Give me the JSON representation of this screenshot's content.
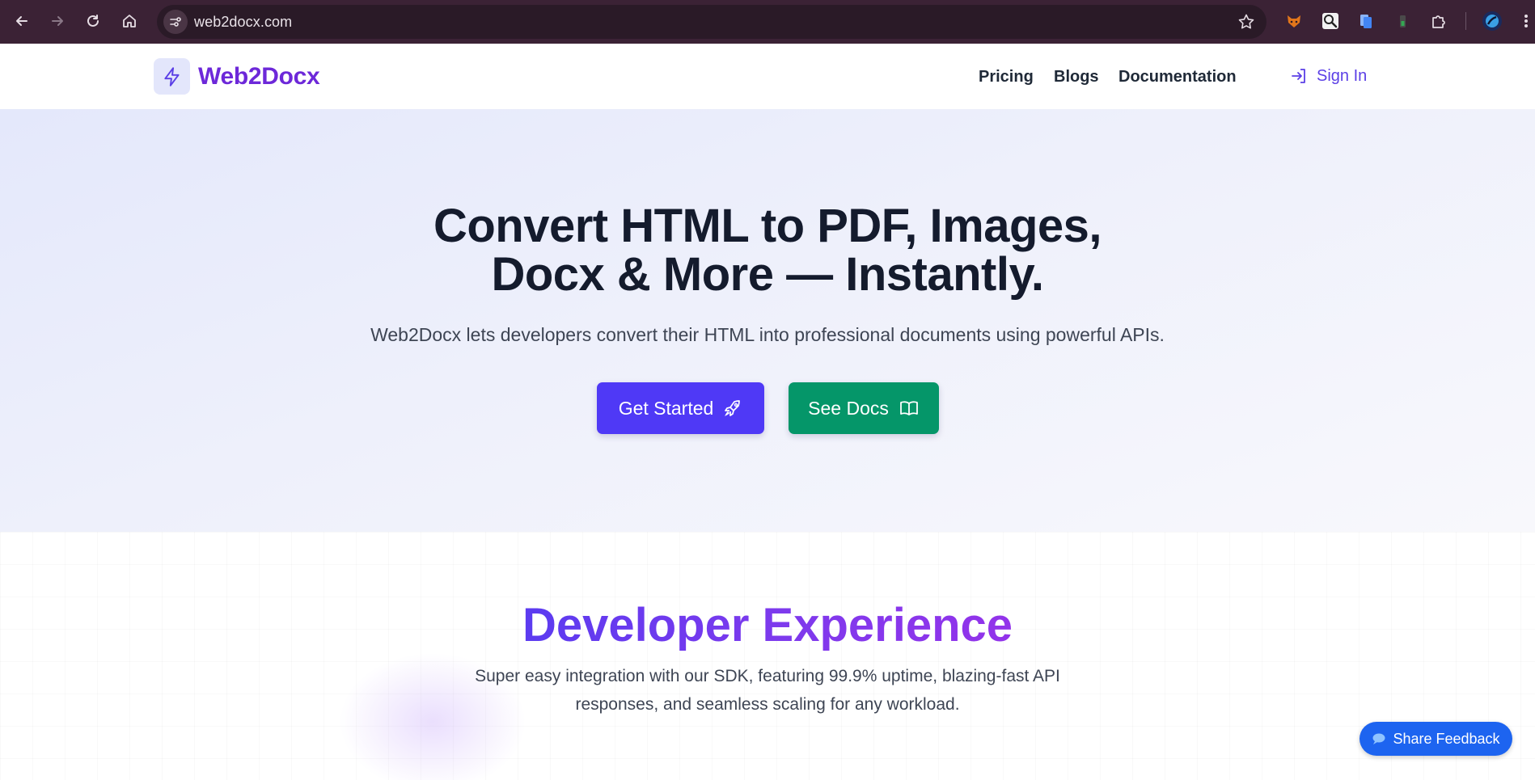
{
  "browser": {
    "url": "web2docx.com",
    "nav_icons": [
      "back-arrow-icon",
      "forward-arrow-icon",
      "reload-icon",
      "home-icon"
    ],
    "extension_icons": [
      "fox-extension-icon",
      "magnifier-extension-icon",
      "docs-extension-icon",
      "battery-extension-icon",
      "puzzle-extensions-icon",
      "profile-avatar-icon",
      "more-menu-icon"
    ]
  },
  "header": {
    "brand": "Web2Docx",
    "nav": [
      "Pricing",
      "Blogs",
      "Documentation"
    ],
    "sign_in": "Sign In"
  },
  "hero": {
    "title_line1": "Convert HTML to PDF, Images,",
    "title_line2": "Docx & More — Instantly.",
    "subtitle": "Web2Docx lets developers convert their HTML into professional documents using powerful APIs.",
    "primary_button": "Get Started",
    "secondary_button": "See Docs"
  },
  "developer": {
    "title": "Developer Experience",
    "description": "Super easy integration with our SDK, featuring 99.9% uptime, blazing-fast API responses, and seamless scaling for any workload."
  },
  "feedback": {
    "label": "Share Feedback"
  },
  "colors": {
    "chrome": "#3b2235",
    "brand": "#6d28d9",
    "primary": "#4f39f6",
    "green": "#059669",
    "feedback": "#1d64f0"
  }
}
